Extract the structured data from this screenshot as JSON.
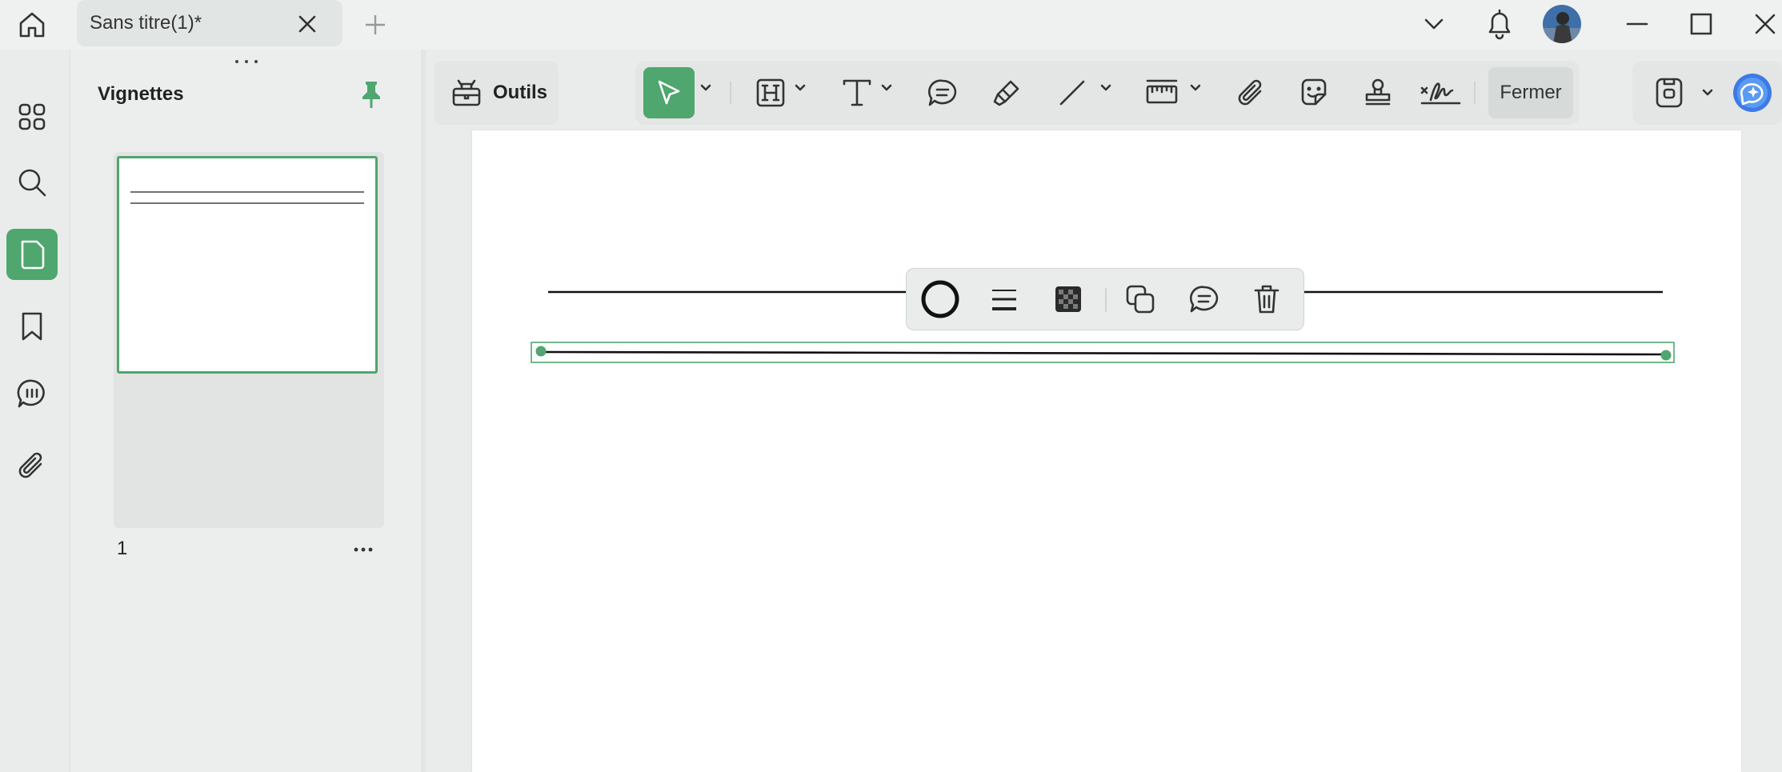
{
  "titlebar": {
    "tab_title": "Sans titre(1)*"
  },
  "rail": {
    "items": [
      "apps-icon",
      "search-icon",
      "page-icon",
      "bookmark-icon",
      "comment-icon",
      "attachment-icon"
    ]
  },
  "panel": {
    "title": "Vignettes",
    "page_number": "1"
  },
  "toolbar": {
    "outils_label": "Outils",
    "close_label": "Fermer"
  },
  "colors": {
    "accent": "#4fa66f",
    "background": "#e9ecea",
    "document": "#ffffff",
    "selection": "#4fa66f"
  }
}
